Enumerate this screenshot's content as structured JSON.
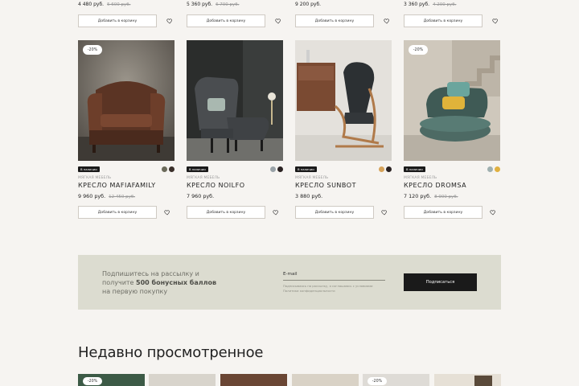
{
  "top_row": [
    {
      "price": "4 480 руб.",
      "old_price": "5 600 руб.",
      "cart": "Добавить в корзину"
    },
    {
      "price": "5 360 руб.",
      "old_price": "6 700 руб.",
      "cart": "Добавить в корзину"
    },
    {
      "price": "9 200 руб.",
      "old_price": "",
      "cart": "Добавить в корзину"
    },
    {
      "price": "3 360 руб.",
      "old_price": "4 200 руб.",
      "cart": "Добавить в корзину"
    }
  ],
  "products": [
    {
      "discount": "-20%",
      "availability": "В наличии",
      "category": "МЯГКАЯ МЕБЕЛЬ",
      "name": "КРЕСЛО MAFIAFAMILY",
      "price": "9 960 руб.",
      "old_price": "12 450 руб.",
      "cart": "Добавить в корзину",
      "swatches": [
        "#6b6a5a",
        "#3a2f2a"
      ]
    },
    {
      "discount": "",
      "availability": "В наличии",
      "category": "МЯГКАЯ МЕБЕЛЬ",
      "name": "КРЕСЛО NOILFO",
      "price": "7 960 руб.",
      "old_price": "",
      "cart": "Добавить в корзину",
      "swatches": [
        "#9aa3a8",
        "#2a2222"
      ]
    },
    {
      "discount": "",
      "availability": "В наличии",
      "category": "МЯГКАЯ МЕБЕЛЬ",
      "name": "КРЕСЛО SUNBOT",
      "price": "3 880 руб.",
      "old_price": "",
      "cart": "Добавить в корзину",
      "swatches": [
        "#d6a35a",
        "#2a2222"
      ]
    },
    {
      "discount": "-20%",
      "availability": "В наличии",
      "category": "МЯГКАЯ МЕБЕЛЬ",
      "name": "КРЕСЛО DROMSA",
      "price": "7 120 руб.",
      "old_price": "8 900 руб.",
      "cart": "Добавить в корзину",
      "swatches": [
        "#9fb0b0",
        "#e0b040"
      ]
    }
  ],
  "newsletter": {
    "line1": "Подпишитесь на рассылку и",
    "line2_pre": "получите ",
    "line2_bold": "500 бонусных баллов",
    "line3": "на первую покупку",
    "email_label": "E-mail",
    "note": "Подписываясь на рассылку, я соглашаюсь с условиями Политики конфиденциальности",
    "button": "Подписаться"
  },
  "recent": {
    "title": "Недавно просмотренное",
    "thumb_badge": "-20%"
  },
  "icons": {
    "heart": "heart-icon"
  }
}
